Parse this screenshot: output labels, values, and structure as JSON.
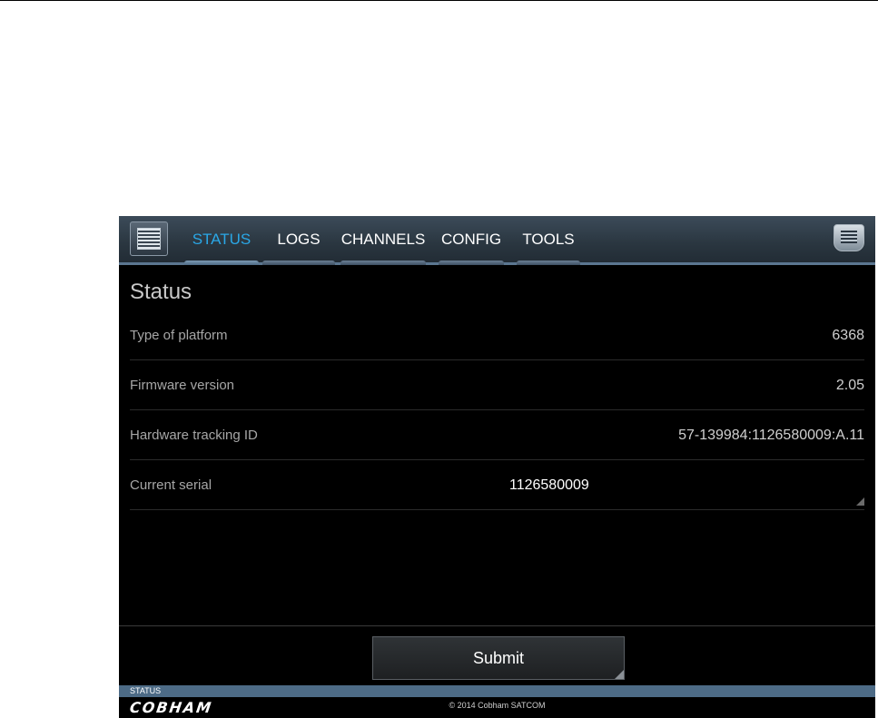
{
  "nav": {
    "tabs": [
      {
        "label": "STATUS",
        "active": true
      },
      {
        "label": "LOGS",
        "active": false
      },
      {
        "label": "CHANNELS",
        "active": false
      },
      {
        "label": "CONFIG",
        "active": false
      },
      {
        "label": "TOOLS",
        "active": false
      }
    ],
    "left_icon": "menu-list-icon",
    "right_icon": "menu-list-icon",
    "active_color": "#2aa7e6"
  },
  "page": {
    "title": "Status",
    "rows": [
      {
        "label": "Type of platform",
        "value": "6368"
      },
      {
        "label": "Firmware version",
        "value": "2.05"
      },
      {
        "label": "Hardware tracking ID",
        "value": "57-139984:1126580009:A.11"
      },
      {
        "label": "Current serial",
        "value": "1126580009"
      }
    ]
  },
  "footer": {
    "submit_label": "Submit",
    "status_text": "STATUS",
    "logo_text": "COBHAM",
    "copyright": "© 2014 Cobham SATCOM"
  }
}
